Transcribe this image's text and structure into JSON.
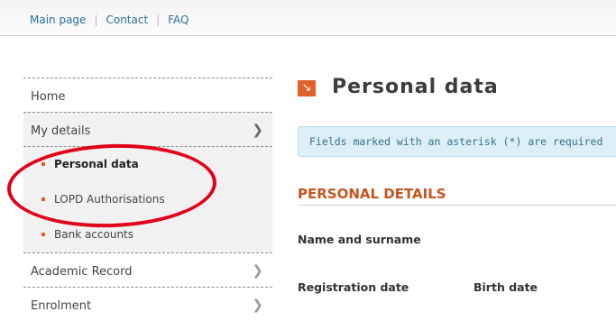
{
  "topnav": {
    "links": [
      "Main page",
      "Contact",
      "FAQ"
    ]
  },
  "sidebar": {
    "items": [
      {
        "label": "Home",
        "has_chevron": false
      },
      {
        "label": "My details",
        "has_chevron": true,
        "expanded": true
      },
      {
        "label": "Academic Record",
        "has_chevron": true
      },
      {
        "label": "Enrolment",
        "has_chevron": true
      }
    ],
    "sub_items": [
      {
        "label": "Personal data",
        "current": true
      },
      {
        "label": "LOPD Authorisations",
        "current": false
      },
      {
        "label": "Bank accounts",
        "current": false
      }
    ],
    "chevron_icon": "chevron-right-icon",
    "bullet_color": "#e2612a"
  },
  "main": {
    "title": "Personal data",
    "title_icon": "arrow-down-right-icon",
    "notice": "Fields marked with an asterisk (*) are required",
    "section_title": "PERSONAL DETAILS",
    "fields": {
      "name": "Name and surname",
      "registration_date": "Registration date",
      "birth_date": "Birth date"
    }
  },
  "colors": {
    "accent": "#e2612a",
    "link": "#2a6f97",
    "annotation": "#e0001a",
    "notice_bg": "#dceff7"
  }
}
